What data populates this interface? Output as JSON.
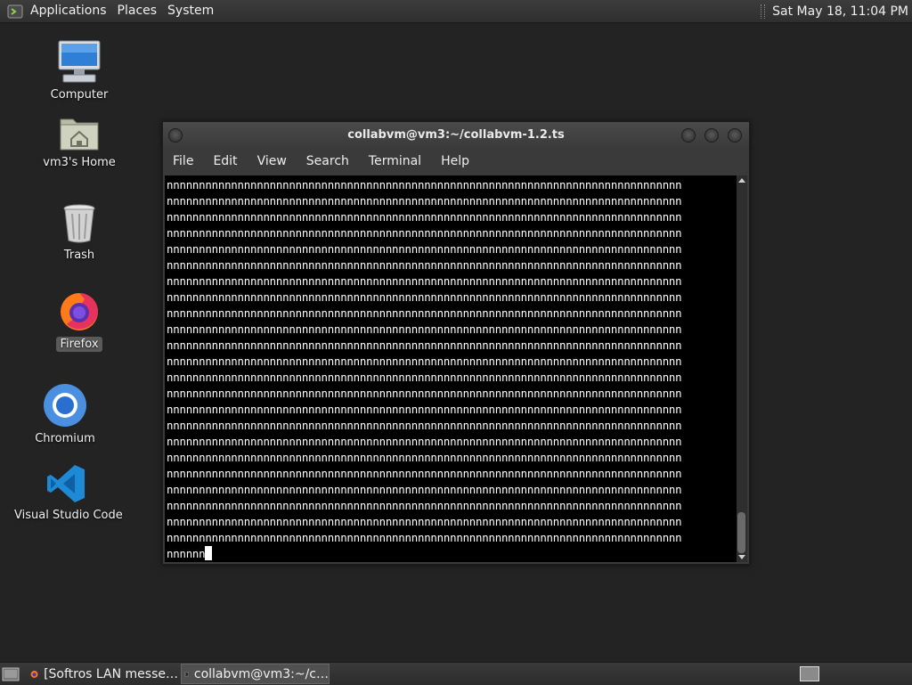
{
  "top_panel": {
    "menus": [
      "Applications",
      "Places",
      "System"
    ],
    "clock": "Sat May 18, 11:04 PM"
  },
  "desktop_icons": [
    {
      "label": "Computer",
      "icon": "computer-icon"
    },
    {
      "label": "vm3's Home",
      "icon": "home-folder-icon"
    },
    {
      "label": "Trash",
      "icon": "trash-icon"
    },
    {
      "label": "Firefox",
      "icon": "firefox-icon",
      "selected": true
    },
    {
      "label": "Chromium",
      "icon": "chromium-icon"
    },
    {
      "label": "Visual Studio Code",
      "icon": "vscode-icon"
    }
  ],
  "terminal": {
    "title": "collabvm@vm3:~/collabvm-1.2.ts",
    "menu": [
      "File",
      "Edit",
      "View",
      "Search",
      "Terminal",
      "Help"
    ],
    "lines": [
      "nnnnnnnnnnnnnnnnnnnnnnnnnnnnnnnnnnnnnnnnnnnnnnnnnnnnnnnnnnnnnnnnnnnnnnnnnnnnnnnn",
      "nnnnnnnnnnnnnnnnnnnnnnnnnnnnnnnnnnnnnnnnnnnnnnnnnnnnnnnnnnnnnnnnnnnnnnnnnnnnnnnn",
      "nnnnnnnnnnnnnnnnnnnnnnnnnnnnnnnnnnnnnnnnnnnnnnnnnnnnnnnnnnnnnnnnnnnnnnnnnnnnnnnn",
      "nnnnnnnnnnnnnnnnnnnnnnnnnnnnnnnnnnnnnnnnnnnnnnnnnnnnnnnnnnnnnnnnnnnnnnnnnnnnnnnn",
      "nnnnnnnnnnnnnnnnnnnnnnnnnnnnnnnnnnnnnnnnnnnnnnnnnnnnnnnnnnnnnnnnnnnnnnnnnnnnnnnn",
      "nnnnnnnnnnnnnnnnnnnnnnnnnnnnnnnnnnnnnnnnnnnnnnnnnnnnnnnnnnnnnnnnnnnnnnnnnnnnnnnn",
      "nnnnnnnnnnnnnnnnnnnnnnnnnnnnnnnnnnnnnnnnnnnnnnnnnnnnnnnnnnnnnnnnnnnnnnnnnnnnnnnn",
      "nnnnnnnnnnnnnnnnnnnnnnnnnnnnnnnnnnnnnnnnnnnnnnnnnnnnnnnnnnnnnnnnnnnnnnnnnnnnnnnn",
      "nnnnnnnnnnnnnnnnnnnnnnnnnnnnnnnnnnnnnnnnnnnnnnnnnnnnnnnnnnnnnnnnnnnnnnnnnnnnnnnn",
      "nnnnnnnnnnnnnnnnnnnnnnnnnnnnnnnnnnnnnnnnnnnnnnnnnnnnnnnnnnnnnnnnnnnnnnnnnnnnnnnn",
      "nnnnnnnnnnnnnnnnnnnnnnnnnnnnnnnnnnnnnnnnnnnnnnnnnnnnnnnnnnnnnnnnnnnnnnnnnnnnnnnn",
      "nnnnnnnnnnnnnnnnnnnnnnnnnnnnnnnnnnnnnnnnnnnnnnnnnnnnnnnnnnnnnnnnnnnnnnnnnnnnnnnn",
      "nnnnnnnnnnnnnnnnnnnnnnnnnnnnnnnnnnnnnnnnnnnnnnnnnnnnnnnnnnnnnnnnnnnnnnnnnnnnnnnn",
      "nnnnnnnnnnnnnnnnnnnnnnnnnnnnnnnnnnnnnnnnnnnnnnnnnnnnnnnnnnnnnnnnnnnnnnnnnnnnnnnn",
      "nnnnnnnnnnnnnnnnnnnnnnnnnnnnnnnnnnnnnnnnnnnnnnnnnnnnnnnnnnnnnnnnnnnnnnnnnnnnnnnn",
      "nnnnnnnnnnnnnnnnnnnnnnnnnnnnnnnnnnnnnnnnnnnnnnnnnnnnnnnnnnnnnnnnnnnnnnnnnnnnnnnn",
      "nnnnnnnnnnnnnnnnnnnnnnnnnnnnnnnnnnnnnnnnnnnnnnnnnnnnnnnnnnnnnnnnnnnnnnnnnnnnnnnn",
      "nnnnnnnnnnnnnnnnnnnnnnnnnnnnnnnnnnnnnnnnnnnnnnnnnnnnnnnnnnnnnnnnnnnnnnnnnnnnnnnn",
      "nnnnnnnnnnnnnnnnnnnnnnnnnnnnnnnnnnnnnnnnnnnnnnnnnnnnnnnnnnnnnnnnnnnnnnnnnnnnnnnn",
      "nnnnnnnnnnnnnnnnnnnnnnnnnnnnnnnnnnnnnnnnnnnnnnnnnnnnnnnnnnnnnnnnnnnnnnnnnnnnnnnn",
      "nnnnnnnnnnnnnnnnnnnnnnnnnnnnnnnnnnnnnnnnnnnnnnnnnnnnnnnnnnnnnnnnnnnnnnnnnnnnnnnn",
      "nnnnnnnnnnnnnnnnnnnnnnnnnnnnnnnnnnnnnnnnnnnnnnnnnnnnnnnnnnnnnnnnnnnnnnnnnnnnnnnn",
      "nnnnnnnnnnnnnnnnnnnnnnnnnnnnnnnnnnnnnnnnnnnnnnnnnnnnnnnnnnnnnnnnnnnnnnnnnnnnnnnn"
    ],
    "prompt_line": "nnnnnn"
  },
  "taskbar": {
    "tasks": [
      {
        "label": "[Softros LAN messe…",
        "icon": "firefox-icon",
        "active": false
      },
      {
        "label": "collabvm@vm3:~/c…",
        "icon": "terminal-icon",
        "active": true
      }
    ]
  }
}
